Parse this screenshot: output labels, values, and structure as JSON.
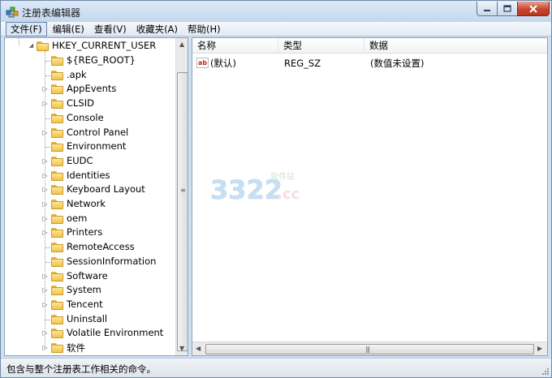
{
  "window": {
    "title": "注册表编辑器"
  },
  "menu": [
    {
      "label": "文件(F)",
      "active": true
    },
    {
      "label": "编辑(E)"
    },
    {
      "label": "查看(V)"
    },
    {
      "label": "收藏夹(A)"
    },
    {
      "label": "帮助(H)"
    }
  ],
  "tree": {
    "root": "HKEY_CURRENT_USER",
    "items": [
      {
        "label": "${REG_ROOT}",
        "expandable": false
      },
      {
        "label": ".apk",
        "expandable": false
      },
      {
        "label": "AppEvents",
        "expandable": true
      },
      {
        "label": "CLSID",
        "expandable": true
      },
      {
        "label": "Console",
        "expandable": false
      },
      {
        "label": "Control Panel",
        "expandable": true
      },
      {
        "label": "Environment",
        "expandable": false
      },
      {
        "label": "EUDC",
        "expandable": true
      },
      {
        "label": "Identities",
        "expandable": true
      },
      {
        "label": "Keyboard Layout",
        "expandable": true
      },
      {
        "label": "Network",
        "expandable": true
      },
      {
        "label": "oem",
        "expandable": true
      },
      {
        "label": "Printers",
        "expandable": true
      },
      {
        "label": "RemoteAccess",
        "expandable": false
      },
      {
        "label": "SessionInformation",
        "expandable": false
      },
      {
        "label": "Software",
        "expandable": true
      },
      {
        "label": "System",
        "expandable": true
      },
      {
        "label": "Tencent",
        "expandable": true
      },
      {
        "label": "Uninstall",
        "expandable": false
      },
      {
        "label": "Volatile Environment",
        "expandable": true
      },
      {
        "label": "软件",
        "expandable": true
      }
    ]
  },
  "list": {
    "columns": [
      "名称",
      "类型",
      "数据"
    ],
    "rows": [
      {
        "name": "(默认)",
        "type": "REG_SZ",
        "data": "(数值未设置)",
        "icon": "string-value-icon"
      }
    ]
  },
  "status": {
    "text": "包含与整个注册表工作相关的命令。"
  },
  "watermark": {
    "main": "3322.cc",
    "sub": "软件站"
  },
  "colors": {
    "accent": "#cfe0f3",
    "close_button": "#c9452c"
  }
}
